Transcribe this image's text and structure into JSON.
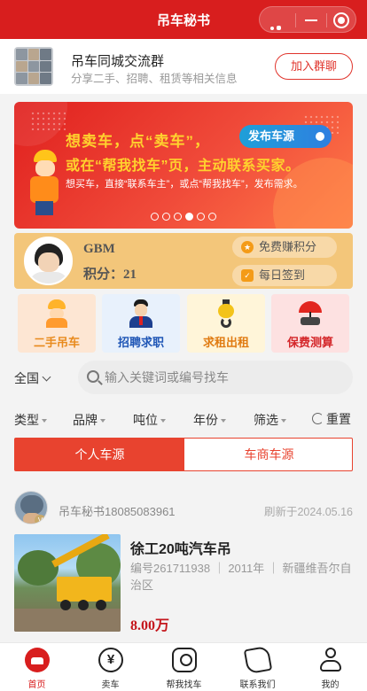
{
  "titlebar": {
    "title": "吊车秘书"
  },
  "group": {
    "name": "吊车同城交流群",
    "desc": "分享二手、招聘、租赁等相关信息",
    "join_label": "加入群聊"
  },
  "banner": {
    "line1": "想卖车，点“卖车”，",
    "button": "发布车源",
    "line2": "或在“帮我找车”页，主动联系买家。",
    "line3": "想买车，直接“联系车主”，或点“帮我找车”，发布需求。",
    "slide_count": 6,
    "active_slide": 4
  },
  "user": {
    "name": "GBM",
    "points_label": "积分：",
    "points": "21",
    "earn_label": "免费赚积分",
    "sign_label": "每日签到"
  },
  "categories": [
    {
      "label": "二手吊车",
      "icon": "worker-icon"
    },
    {
      "label": "招聘求职",
      "icon": "recruiter-icon"
    },
    {
      "label": "求租出租",
      "icon": "hook-icon"
    },
    {
      "label": "保费测算",
      "icon": "umbrella-car-icon"
    }
  ],
  "search": {
    "region": "全国",
    "placeholder": "输入关键词或编号找车"
  },
  "filters": {
    "items": [
      "类型",
      "品牌",
      "吨位",
      "年份",
      "筛选"
    ],
    "reset": "重置"
  },
  "tabs": [
    "个人车源",
    "车商车源"
  ],
  "listing": {
    "seller": "吊车秘书18085083961",
    "refreshed": "刷新于2024.05.16",
    "title": "徐工20吨汽车吊",
    "detail": "编号261711938 ｜ 2011年 ｜ 新疆维吾尔自治区",
    "price": "8.00万"
  },
  "tabbar": [
    {
      "label": "首页",
      "icon": "home-icon",
      "active": true
    },
    {
      "label": "卖车",
      "icon": "yen-icon",
      "active": false
    },
    {
      "label": "帮我找车",
      "icon": "find-car-icon",
      "active": false
    },
    {
      "label": "联系我们",
      "icon": "phone-icon",
      "active": false
    },
    {
      "label": "我的",
      "icon": "profile-icon",
      "active": false
    }
  ],
  "colors": {
    "brand_red": "#d81e1e",
    "accent_orange": "#e8432f",
    "user_card": "#f3c67a"
  }
}
